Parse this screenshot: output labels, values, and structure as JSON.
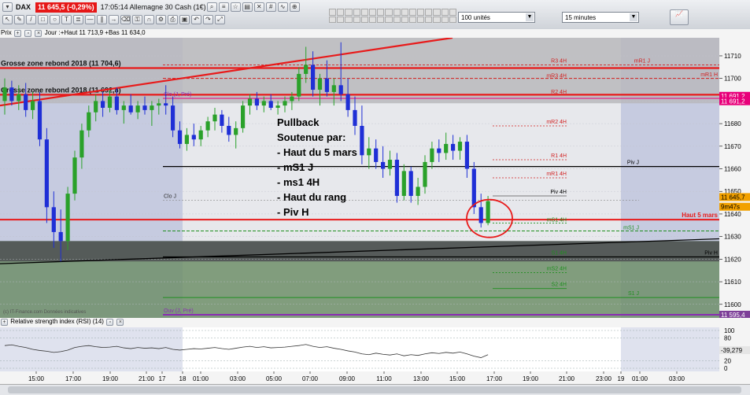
{
  "toolbar": {
    "symbol": "DAX",
    "price_badge": "11 645,5 (-0,29%)",
    "time_label": "17:05:14 Allemagne 30 Cash (1€)",
    "units_select": "100 unités",
    "period_select": "15 minutes",
    "header_text": "Prix",
    "day_info": "Jour :+Haut 11 713,9 +Bas 11 634,0"
  },
  "rsi": {
    "title": "Relative strength index (RSI) (14)",
    "value_label": "-39,279",
    "y_ticks": [
      "100",
      "80",
      "20",
      "0"
    ]
  },
  "chart_data": {
    "type": "candlestick",
    "instrument": "DAX",
    "interval": "15 minutes",
    "ylim": [
      11594,
      11718
    ],
    "y_ticks": [
      11600,
      11610,
      11620,
      11630,
      11640,
      11650,
      11660,
      11670,
      11680,
      11690,
      11700,
      11710
    ],
    "x_ticks": [
      "15:00",
      "17:00",
      "19:00",
      "21:00",
      "17",
      "18",
      "01:00",
      "03:00",
      "05:00",
      "07:00",
      "09:00",
      "11:00",
      "13:00",
      "15:00",
      "17:00",
      "19:00",
      "21:00",
      "23:00",
      "19",
      "01:00",
      "03:00"
    ],
    "price_badges": [
      {
        "value": "11 691,2",
        "color": "#e8007a"
      },
      {
        "value": "11 691,2",
        "color": "#e8007a"
      },
      {
        "value": "11 645,7",
        "color": "#f2a100"
      },
      {
        "value": "9m47s",
        "color": "#f2a100"
      },
      {
        "value": "11 595,4",
        "color": "#7d3f98"
      }
    ],
    "candles": [
      {
        "o": 11690,
        "h": 11700,
        "l": 11684,
        "c": 11696
      },
      {
        "o": 11696,
        "h": 11699,
        "l": 11688,
        "c": 11690
      },
      {
        "o": 11690,
        "h": 11697,
        "l": 11686,
        "c": 11693
      },
      {
        "o": 11693,
        "h": 11698,
        "l": 11683,
        "c": 11686
      },
      {
        "o": 11686,
        "h": 11694,
        "l": 11682,
        "c": 11690
      },
      {
        "o": 11690,
        "h": 11694,
        "l": 11670,
        "c": 11673
      },
      {
        "o": 11673,
        "h": 11678,
        "l": 11636,
        "c": 11643
      },
      {
        "o": 11643,
        "h": 11650,
        "l": 11625,
        "c": 11632
      },
      {
        "o": 11632,
        "h": 11642,
        "l": 11619,
        "c": 11628
      },
      {
        "o": 11628,
        "h": 11652,
        "l": 11624,
        "c": 11649
      },
      {
        "o": 11649,
        "h": 11668,
        "l": 11646,
        "c": 11665
      },
      {
        "o": 11665,
        "h": 11680,
        "l": 11660,
        "c": 11677
      },
      {
        "o": 11677,
        "h": 11688,
        "l": 11674,
        "c": 11685
      },
      {
        "o": 11685,
        "h": 11693,
        "l": 11681,
        "c": 11690
      },
      {
        "o": 11690,
        "h": 11694,
        "l": 11683,
        "c": 11687
      },
      {
        "o": 11687,
        "h": 11695,
        "l": 11685,
        "c": 11692
      },
      {
        "o": 11692,
        "h": 11696,
        "l": 11684,
        "c": 11686
      },
      {
        "o": 11686,
        "h": 11690,
        "l": 11680,
        "c": 11688
      },
      {
        "o": 11688,
        "h": 11693,
        "l": 11684,
        "c": 11685
      },
      {
        "o": 11685,
        "h": 11690,
        "l": 11682,
        "c": 11688
      },
      {
        "o": 11688,
        "h": 11692,
        "l": 11684,
        "c": 11686
      },
      {
        "o": 11686,
        "h": 11690,
        "l": 11679,
        "c": 11688
      },
      {
        "o": 11688,
        "h": 11691,
        "l": 11684,
        "c": 11689
      },
      {
        "o": 11689,
        "h": 11697,
        "l": 11684,
        "c": 11688
      },
      {
        "o": 11688,
        "h": 11692,
        "l": 11674,
        "c": 11677
      },
      {
        "o": 11677,
        "h": 11681,
        "l": 11669,
        "c": 11671
      },
      {
        "o": 11671,
        "h": 11678,
        "l": 11668,
        "c": 11675
      },
      {
        "o": 11675,
        "h": 11680,
        "l": 11670,
        "c": 11673
      },
      {
        "o": 11673,
        "h": 11679,
        "l": 11670,
        "c": 11677
      },
      {
        "o": 11677,
        "h": 11683,
        "l": 11674,
        "c": 11681
      },
      {
        "o": 11681,
        "h": 11687,
        "l": 11677,
        "c": 11684
      },
      {
        "o": 11684,
        "h": 11686,
        "l": 11676,
        "c": 11679
      },
      {
        "o": 11679,
        "h": 11683,
        "l": 11672,
        "c": 11675
      },
      {
        "o": 11675,
        "h": 11681,
        "l": 11669,
        "c": 11678
      },
      {
        "o": 11678,
        "h": 11690,
        "l": 11676,
        "c": 11688
      },
      {
        "o": 11688,
        "h": 11693,
        "l": 11684,
        "c": 11691
      },
      {
        "o": 11691,
        "h": 11694,
        "l": 11686,
        "c": 11688
      },
      {
        "o": 11688,
        "h": 11692,
        "l": 11685,
        "c": 11690
      },
      {
        "o": 11690,
        "h": 11693,
        "l": 11686,
        "c": 11687
      },
      {
        "o": 11687,
        "h": 11690,
        "l": 11684,
        "c": 11688
      },
      {
        "o": 11688,
        "h": 11692,
        "l": 11685,
        "c": 11690
      },
      {
        "o": 11690,
        "h": 11694,
        "l": 11686,
        "c": 11692
      },
      {
        "o": 11692,
        "h": 11705,
        "l": 11690,
        "c": 11702
      },
      {
        "o": 11702,
        "h": 11714,
        "l": 11698,
        "c": 11706
      },
      {
        "o": 11706,
        "h": 11712,
        "l": 11692,
        "c": 11695
      },
      {
        "o": 11695,
        "h": 11702,
        "l": 11688,
        "c": 11700
      },
      {
        "o": 11700,
        "h": 11708,
        "l": 11692,
        "c": 11694
      },
      {
        "o": 11694,
        "h": 11700,
        "l": 11688,
        "c": 11697
      },
      {
        "o": 11697,
        "h": 11716,
        "l": 11690,
        "c": 11693
      },
      {
        "o": 11693,
        "h": 11700,
        "l": 11683,
        "c": 11686
      },
      {
        "o": 11686,
        "h": 11692,
        "l": 11675,
        "c": 11679
      },
      {
        "o": 11679,
        "h": 11688,
        "l": 11662,
        "c": 11666
      },
      {
        "o": 11666,
        "h": 11674,
        "l": 11660,
        "c": 11669
      },
      {
        "o": 11669,
        "h": 11673,
        "l": 11660,
        "c": 11663
      },
      {
        "o": 11663,
        "h": 11670,
        "l": 11656,
        "c": 11660
      },
      {
        "o": 11660,
        "h": 11668,
        "l": 11657,
        "c": 11664
      },
      {
        "o": 11664,
        "h": 11667,
        "l": 11645,
        "c": 11648
      },
      {
        "o": 11648,
        "h": 11662,
        "l": 11646,
        "c": 11659
      },
      {
        "o": 11659,
        "h": 11661,
        "l": 11645,
        "c": 11648
      },
      {
        "o": 11648,
        "h": 11656,
        "l": 11644,
        "c": 11652
      },
      {
        "o": 11652,
        "h": 11666,
        "l": 11649,
        "c": 11663
      },
      {
        "o": 11663,
        "h": 11672,
        "l": 11660,
        "c": 11669
      },
      {
        "o": 11669,
        "h": 11673,
        "l": 11663,
        "c": 11667
      },
      {
        "o": 11667,
        "h": 11676,
        "l": 11664,
        "c": 11671
      },
      {
        "o": 11671,
        "h": 11675,
        "l": 11664,
        "c": 11668
      },
      {
        "o": 11668,
        "h": 11674,
        "l": 11664,
        "c": 11672
      },
      {
        "o": 11672,
        "h": 11675,
        "l": 11656,
        "c": 11660
      },
      {
        "o": 11660,
        "h": 11663,
        "l": 11640,
        "c": 11643
      },
      {
        "o": 11643,
        "h": 11649,
        "l": 11634,
        "c": 11636
      },
      {
        "o": 11636,
        "h": 11648,
        "l": 11635,
        "c": 11645.7
      }
    ],
    "horizontal_levels": [
      {
        "label": "Grosse zone rebond 2018 (11 704,6)",
        "value": 11704.6,
        "color": "#e81a1a",
        "style": "solid"
      },
      {
        "label": "Grosse zone rebond 2018 (11 692,8)",
        "value": 11692.8,
        "color": "#e81a1a",
        "style": "solid"
      },
      {
        "label": "Clo (J, Pré)",
        "value": 11691.2,
        "color": "#e8007a",
        "style": "solid"
      },
      {
        "label": "R3 4H",
        "value": 11706,
        "color": "#d21e1e",
        "style": "dashed"
      },
      {
        "label": "mR1 J",
        "value": 11706,
        "color": "#d21e1e",
        "style": "dashed"
      },
      {
        "label": "mR3 4H",
        "value": 11700,
        "color": "#d21e1e",
        "style": "dashed"
      },
      {
        "label": "mR1 H",
        "value": 11700.5,
        "color": "#d21e1e",
        "style": "dashed"
      },
      {
        "label": "R2 4H",
        "value": 11692.5,
        "color": "#d21e1e",
        "style": "dashed"
      },
      {
        "label": "mR2 4H",
        "value": 11679,
        "color": "#d21e1e",
        "style": "dashed"
      },
      {
        "label": "R1 4H",
        "value": 11664,
        "color": "#d21e1e",
        "style": "dashed"
      },
      {
        "label": "mR1 4H",
        "value": 11656,
        "color": "#d21e1e",
        "style": "dashed"
      },
      {
        "label": "Piv J",
        "value": 11661,
        "color": "#000000",
        "style": "solid"
      },
      {
        "label": "Piv 4H",
        "value": 11648,
        "color": "#555555",
        "style": "solid"
      },
      {
        "label": "Clo J",
        "value": 11646,
        "color": "#888888",
        "style": "dashed"
      },
      {
        "label": "Haut 5 mars",
        "value": 11637.5,
        "color": "#e81a1a",
        "style": "solid"
      },
      {
        "label": "mS1 4H",
        "value": 11636,
        "color": "#1f8f1f",
        "style": "dashed"
      },
      {
        "label": "mS1 J",
        "value": 11632.5,
        "color": "#1f8f1f",
        "style": "dashed"
      },
      {
        "label": "Piv H",
        "value": 11621,
        "color": "#000000",
        "style": "solid"
      },
      {
        "label": "S1 4H",
        "value": 11621,
        "color": "#1f8f1f",
        "style": "solid"
      },
      {
        "label": "mS2 4H",
        "value": 11614,
        "color": "#1f8f1f",
        "style": "dashed"
      },
      {
        "label": "S2 4H",
        "value": 11607,
        "color": "#1f8f1f",
        "style": "solid"
      },
      {
        "label": "S1 J",
        "value": 11603,
        "color": "#1f8f1f",
        "style": "solid"
      },
      {
        "label": "Ouv (J, Pré)",
        "value": 11595.4,
        "color": "#8a2db3",
        "style": "solid"
      }
    ],
    "annotation": {
      "lines": [
        "Pullback",
        "Soutenue par:",
        "- Haut du 5 mars",
        "- mS1 J",
        "- ms1 4H",
        "- Haut du rang",
        "- Piv H"
      ]
    },
    "source_note": "(c) IT-Finance.com  Données indicatives"
  }
}
